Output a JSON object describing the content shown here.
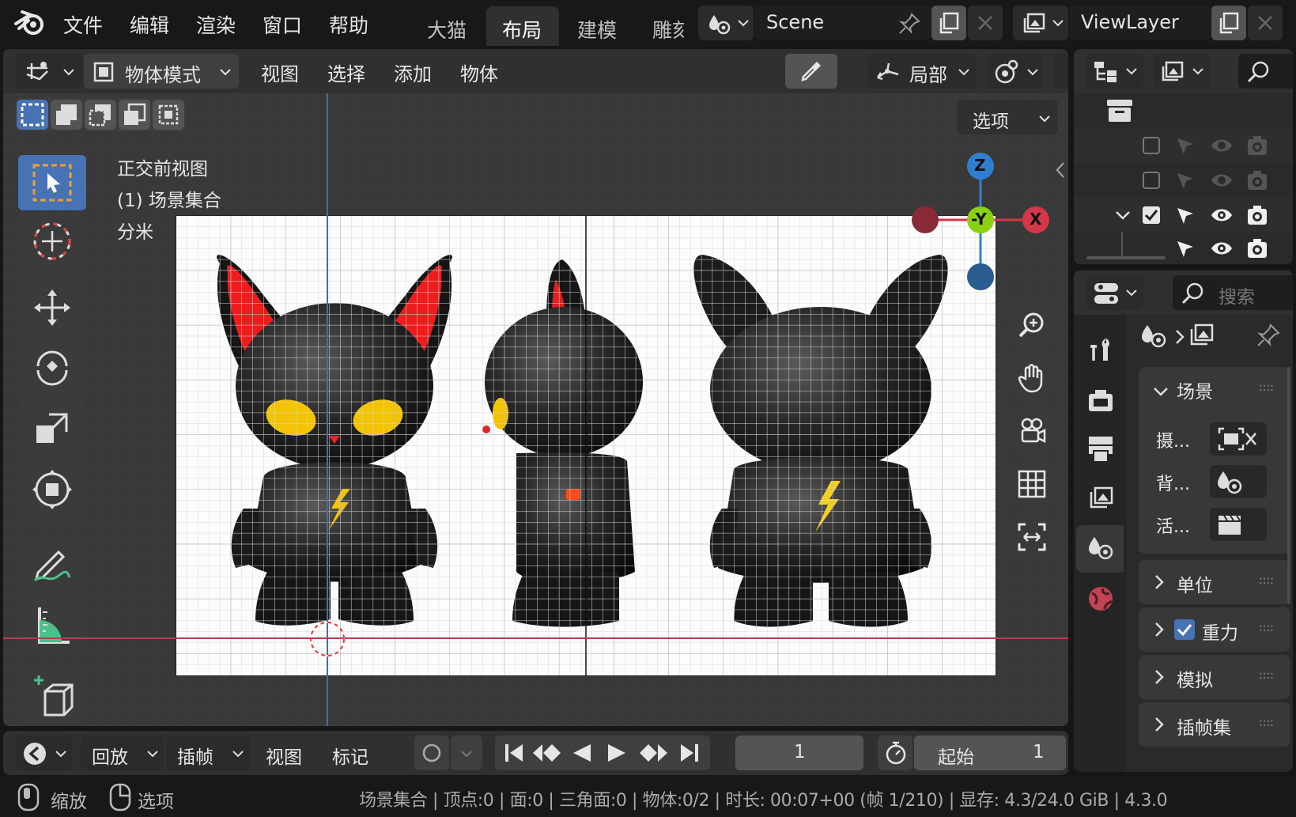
{
  "topbar": {
    "menus": [
      "文件",
      "编辑",
      "渲染",
      "窗口",
      "帮助"
    ],
    "workspace_tabs": [
      "大猫",
      "布局",
      "建模",
      "雕刻"
    ],
    "active_tab": "布局",
    "scene_name": "Scene",
    "view_layer_name": "ViewLayer"
  },
  "viewport_header": {
    "mode": "物体模式",
    "menus": [
      "视图",
      "选择",
      "添加",
      "物体"
    ],
    "transform_orientation": "局部",
    "options_label": "选项"
  },
  "viewport": {
    "overlay_lines": [
      "正交前视图",
      "(1) 场景集合",
      "分米"
    ],
    "gizmo_axes": {
      "z": "Z",
      "y": "-Y",
      "x": "X"
    },
    "accent": "#4772b3"
  },
  "outliner": {
    "rows": 4
  },
  "properties": {
    "search_placeholder": "搜索",
    "scene_panel_title": "场景",
    "scene_fields": [
      "摄...",
      "背...",
      "活..."
    ],
    "collapsed_sections": [
      "单位",
      "重力",
      "模拟",
      "插帧集"
    ],
    "gravity_checked": true
  },
  "timeline": {
    "menus": [
      "回放",
      "插帧",
      "视图",
      "标记"
    ],
    "current_frame": "1",
    "start_label": "起始",
    "start_value": "1"
  },
  "statusbar": {
    "left": [
      "缩放",
      "选项"
    ],
    "stats": "场景集合 | 顶点:0 | 面:0 | 三角面:0 | 物体:0/2 | 时长: 00:07+00 (帧 1/210) | 显存: 4.3/24.0 GiB | 4.3.0"
  },
  "colors": {
    "x_axis": "#d4374a",
    "y_axis": "#8ad10f",
    "z_axis": "#2f7fd1",
    "active_blue": "#4772b3"
  }
}
